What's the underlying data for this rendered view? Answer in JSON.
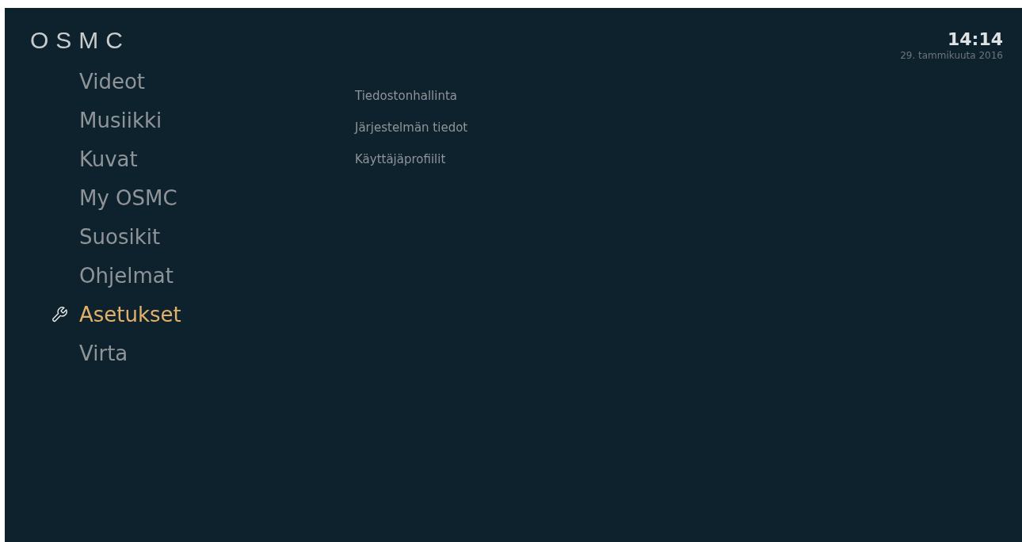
{
  "logo": "OSMC",
  "clock": {
    "time": "14:14",
    "date": "29. tammikuuta 2016"
  },
  "main_menu": [
    {
      "label": "Videot",
      "selected": false
    },
    {
      "label": "Musiikki",
      "selected": false
    },
    {
      "label": "Kuvat",
      "selected": false
    },
    {
      "label": "My OSMC",
      "selected": false
    },
    {
      "label": "Suosikit",
      "selected": false
    },
    {
      "label": "Ohjelmat",
      "selected": false
    },
    {
      "label": "Asetukset",
      "selected": true
    },
    {
      "label": "Virta",
      "selected": false
    }
  ],
  "submenu": [
    "Tiedostonhallinta",
    "Järjestelmän tiedot",
    "Käyttäjäprofiilit"
  ]
}
